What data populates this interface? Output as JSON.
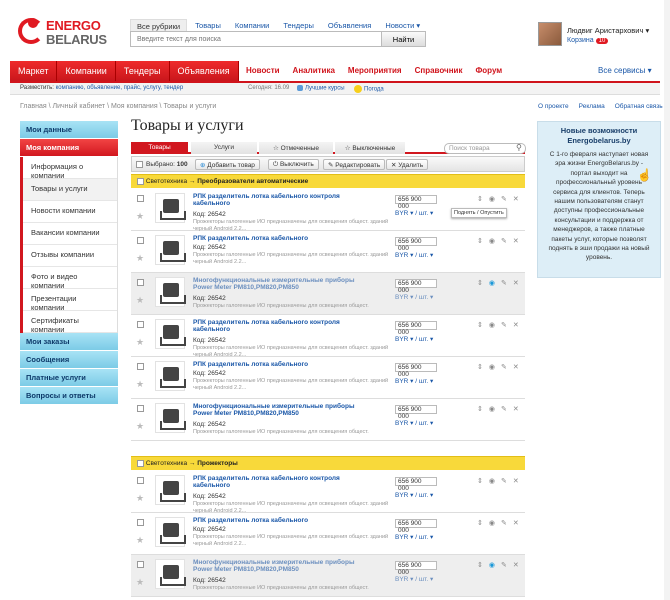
{
  "logo": {
    "line1": "ENERGO",
    "line2": "BELARUS"
  },
  "search": {
    "scopes": [
      "Все рубрики",
      "Товары",
      "Компании",
      "Тендеры",
      "Объявления",
      "Новости ▾"
    ],
    "placeholder": "Введите текст для поиска",
    "button": "Найти"
  },
  "user": {
    "name": "Людвиг Аристархович ▾",
    "cart": "Корзина",
    "cart_count": "10"
  },
  "nav": {
    "main": [
      "Маркет",
      "Компании",
      "Тендеры",
      "Объявления"
    ],
    "secondary": [
      "Новости",
      "Аналитика",
      "Мероприятия",
      "Справочник",
      "Форум"
    ],
    "all_services": "Все сервисы ▾"
  },
  "placebar": {
    "label": "Разместить:",
    "links": [
      "компанию,",
      "объявление,",
      "прайс,",
      "услугу,",
      "тендер"
    ],
    "today": "Сегодня: 16.09",
    "courses": "Лучшие курсы",
    "weather": "Погода"
  },
  "breadcrumbs": "Главная \\ Личный кабинет \\ Моя компания \\ Товары и услуги",
  "toplinks": [
    "О проекте",
    "Реклама",
    "Обратная связь"
  ],
  "left_menu": {
    "my_data": "Мои данные",
    "my_company": "Моя компания",
    "company_items": [
      "Информация о компании",
      "Товары и услуги",
      "Новости компании",
      "Вакансии компании",
      "Отзывы компании",
      "Фото и видео компании",
      "Презентации компании",
      "Сертификаты компании"
    ],
    "others": [
      "Мои заказы",
      "Сообщения",
      "Платные услуги",
      "Вопросы и ответы"
    ]
  },
  "page_title": "Товары и услуги",
  "tabs": [
    "Товары",
    "Услуги",
    "☆ Отмеченные",
    "☆ Выключенные"
  ],
  "product_search_placeholder": "Поиск товара",
  "toolbar": {
    "selected_label": "Выбрано:",
    "selected_count": "100",
    "add": "Добавить товар",
    "disable": "Выключить",
    "edit": "Редактировать",
    "delete": "Удалить"
  },
  "categories": [
    {
      "path": "Светотехника",
      "sub": "Преобразователи автоматические"
    },
    {
      "path": "Светотехника",
      "sub": "Прожекторы"
    }
  ],
  "tooltip": "Поднять / Опустить",
  "products": [
    {
      "name": "РПК разделитель лотка кабельного контроля кабельного",
      "code": "Код: 26542",
      "desc": "Прожекторы галогенные ИО предназначены для освещения общест. зданий черный Android 2.2...",
      "price": "656 900 000",
      "currency": "BYR ▾",
      "unit": "шт. ▾"
    },
    {
      "name": "РПК разделитель лотка кабельного",
      "code": "Код: 26542",
      "desc": "Прожекторы галогенные ИО предназначены для освещения общест. зданий черный Android 2.2...",
      "price": "656 900 000",
      "currency": "BYR ▾",
      "unit": "шт. ▾"
    },
    {
      "name": "Многофункциональные измерительные приборы Power Meter PM810,PM820,PM850",
      "code": "Код: 26542",
      "desc": "Прожекторы галогенные ИО предназначены для освещения общест.",
      "price": "656 900 000",
      "currency": "BYR ▾",
      "unit": "шт. ▾"
    },
    {
      "name": "РПК разделитель лотка кабельного контроля кабельного",
      "code": "Код: 26542",
      "desc": "Прожекторы галогенные ИО предназначены для освещения общест. зданий черный Android 2.2...",
      "price": "656 900 000",
      "currency": "BYR ▾",
      "unit": "шт. ▾"
    },
    {
      "name": "РПК разделитель лотка кабельного",
      "code": "Код: 26542",
      "desc": "Прожекторы галогенные ИО предназначены для освещения общест. зданий черный Android 2.2...",
      "price": "656 900 000",
      "currency": "BYR ▾",
      "unit": "шт. ▾"
    },
    {
      "name": "Многофункциональные измерительные приборы Power Meter PM810,PM820,PM850",
      "code": "Код: 26542",
      "desc": "Прожекторы галогенные ИО предназначены для освещения общест.",
      "price": "656 900 000",
      "currency": "BYR ▾",
      "unit": "шт. ▾"
    },
    {
      "name": "РПК разделитель лотка кабельного контроля кабельного",
      "code": "Код: 26542",
      "desc": "Прожекторы галогенные ИО предназначены для освещения общест. зданий черный Android 2.2...",
      "price": "656 900 000",
      "currency": "BYR ▾",
      "unit": "шт. ▾"
    },
    {
      "name": "РПК разделитель лотка кабельного",
      "code": "Код: 26542",
      "desc": "Прожекторы галогенные ИО предназначены для освещения общест. зданий черный Android 2.2...",
      "price": "656 900 000",
      "currency": "BYR ▾",
      "unit": "шт. ▾"
    },
    {
      "name": "Многофункциональные измерительные приборы Power Meter PM810,PM820,PM850",
      "code": "Код: 26542",
      "desc": "Прожекторы галогенные ИО предназначены для освещения общест.",
      "price": "656 900 000",
      "currency": "BYR ▾",
      "unit": "шт. ▾"
    }
  ],
  "promo": {
    "title": "Новые возможности Energobelarus.by",
    "text": "С 1-го февраля наступает новая эра жизни EnergoBelarus.by - портал выходит на профессиональный уровень сервиса для клиентов. Теперь нашим пользователям станут доступны профессиональные консультации и поддержка от менеджеров, а также платные пакеты услуг, которые позволят поднять в эши продажи на новый уровень."
  },
  "colors": {
    "brand_red": "#d1171f",
    "category_yellow": "#f8d93a",
    "menu_blue": "#7ccbe6",
    "promo_bg": "#ddeef7",
    "link": "#1a57a8"
  }
}
